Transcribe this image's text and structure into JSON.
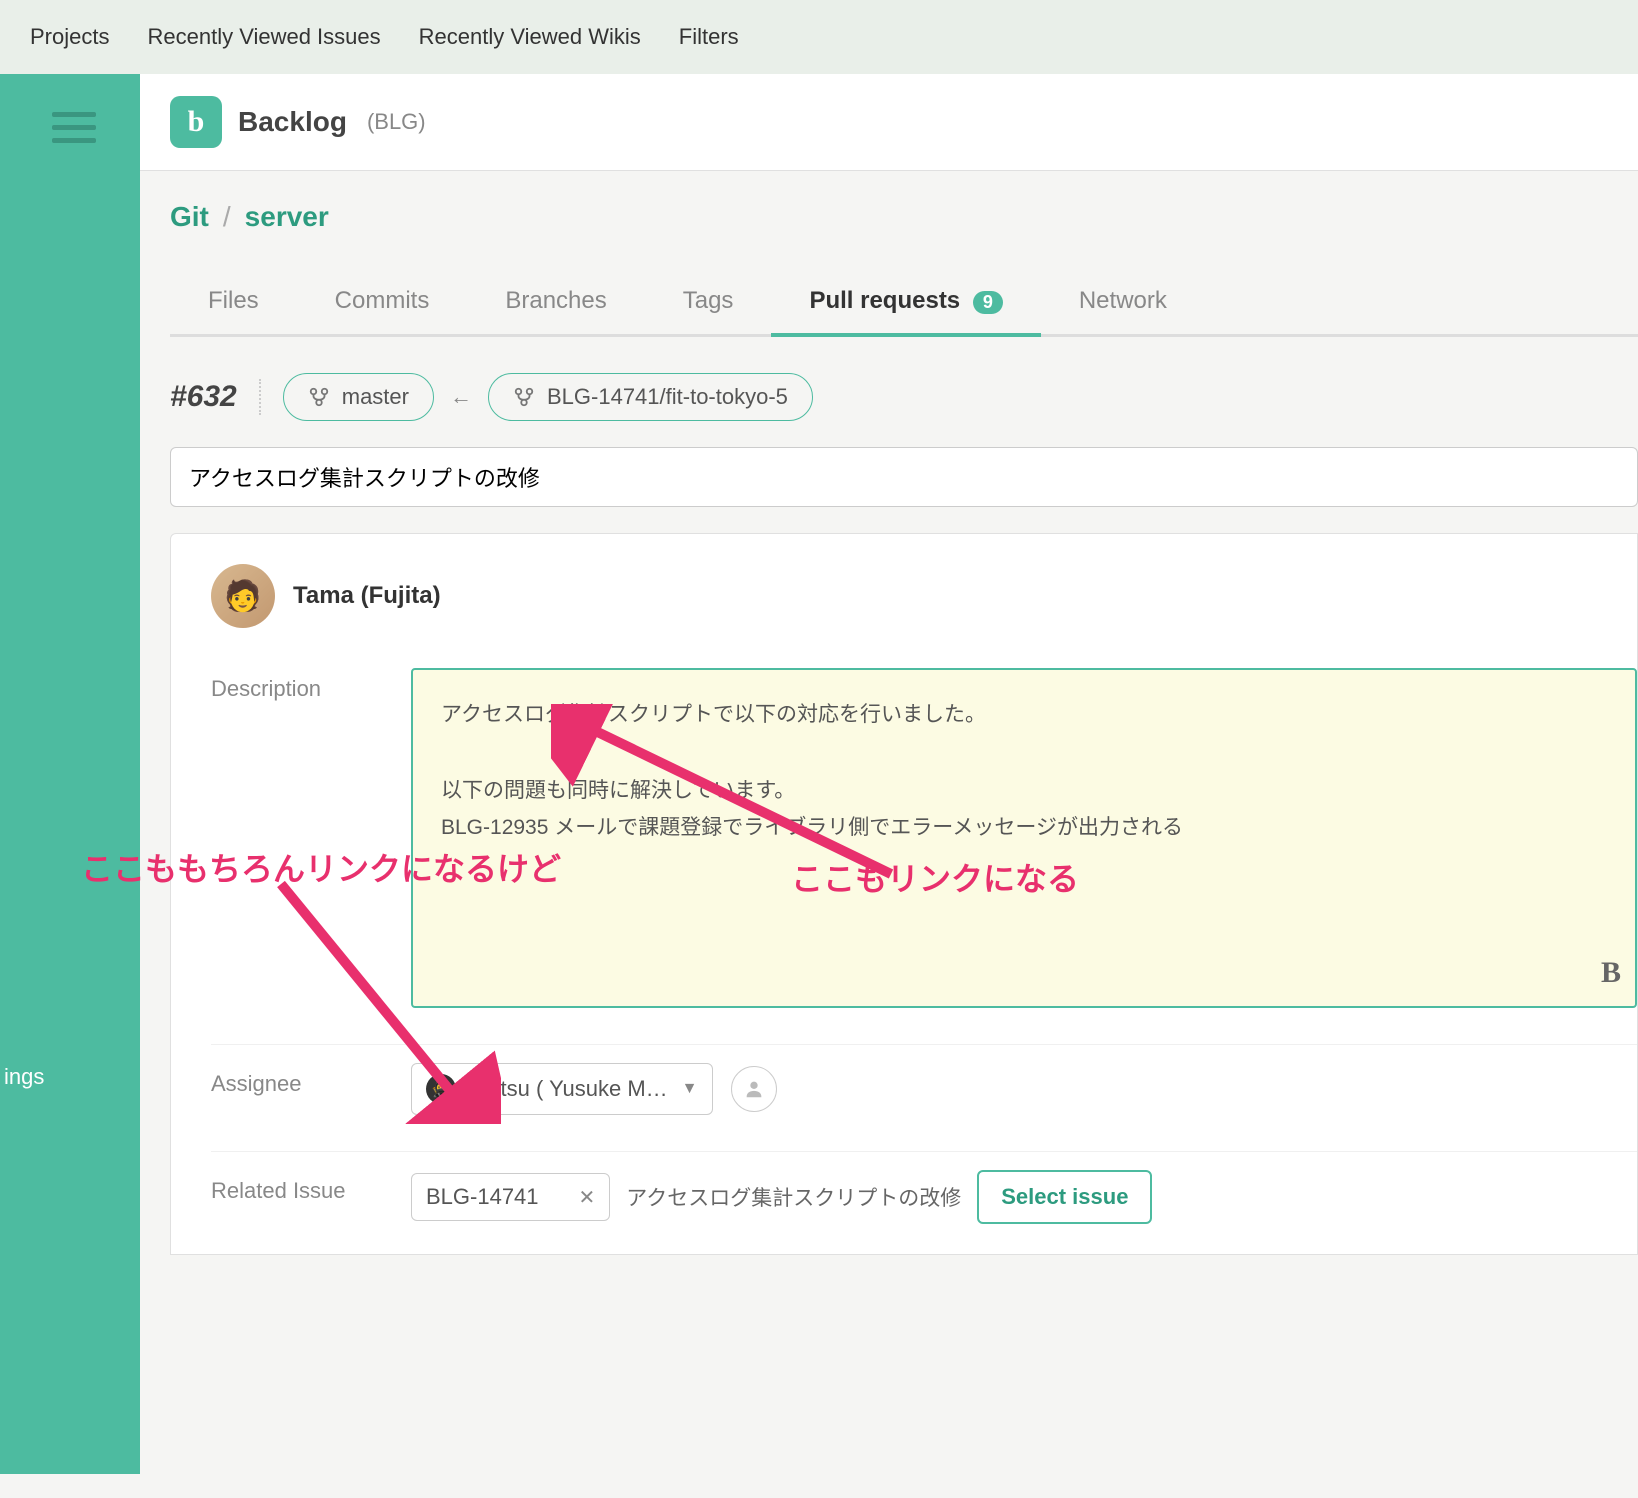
{
  "topbar": {
    "projects": "Projects",
    "recent_issues": "Recently Viewed Issues",
    "recent_wikis": "Recently Viewed Wikis",
    "filters": "Filters"
  },
  "sidebar": {
    "label_fragment": "ings"
  },
  "project": {
    "icon_letter": "b",
    "name": "Backlog",
    "key": "(BLG)"
  },
  "breadcrumb": {
    "git": "Git",
    "sep": "/",
    "repo": "server"
  },
  "tabs": {
    "files": "Files",
    "commits": "Commits",
    "branches": "Branches",
    "tags": "Tags",
    "pull_requests": "Pull requests",
    "pr_badge": "9",
    "network": "Network"
  },
  "pr": {
    "number": "#632",
    "target_branch": "master",
    "source_branch": "BLG-14741/fit-to-tokyo-5",
    "title": "アクセスログ集計スクリプトの改修"
  },
  "author": {
    "name": "Tama (Fujita)"
  },
  "fields": {
    "description_label": "Description",
    "description_line1": "アクセスログ集計スクリプトで以下の対応を行いました。",
    "description_line2": "以下の問題も同時に解決しています。",
    "description_line3": "BLG-12935 メールで課題登録でライブラリ側でエラーメッセージが出力される",
    "bold_btn": "B",
    "assignee_label": "Assignee",
    "assignee_value": "matsu ( Yusuke M…",
    "related_label": "Related Issue",
    "related_key": "BLG-14741",
    "related_title": "アクセスログ集計スクリプトの改修",
    "select_issue_btn": "Select issue"
  },
  "annotations": {
    "left": "ここももちろんリンクになるけど",
    "right": "ここもリンクになる"
  }
}
